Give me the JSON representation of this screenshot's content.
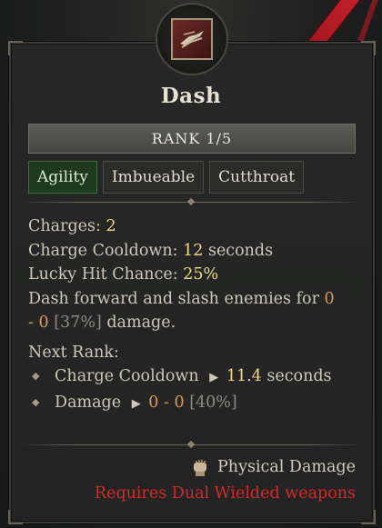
{
  "skill": {
    "name": "Dash",
    "rank_label": "RANK 1/5",
    "tags": [
      {
        "label": "Agility",
        "active": true
      },
      {
        "label": "Imbueable",
        "active": false
      },
      {
        "label": "Cutthroat",
        "active": false
      }
    ]
  },
  "stats": {
    "charges_label": "Charges:",
    "charges_value": "2",
    "cooldown_label": "Charge Cooldown:",
    "cooldown_value": "12",
    "cooldown_unit": "seconds",
    "lucky_label": "Lucky Hit Chance:",
    "lucky_value": "25%",
    "desc_part1": "Dash forward and slash enemies for",
    "desc_min": "0",
    "desc_sep": "-",
    "desc_max": "0",
    "desc_pct": "[37%]",
    "desc_part2": "damage."
  },
  "next_rank": {
    "title": "Next Rank:",
    "cooldown_label": "Charge Cooldown",
    "cooldown_value": "11.4",
    "cooldown_unit": "seconds",
    "damage_label": "Damage",
    "damage_min": "0",
    "damage_sep": "-",
    "damage_max": "0",
    "damage_pct": "[40%]"
  },
  "footer": {
    "damage_type": "Physical Damage",
    "requirement": "Requires Dual Wielded weapons"
  },
  "colors": {
    "value_yellow": "#f0d98a",
    "value_orange": "#d99b54",
    "requirement_red": "#d32a2a",
    "active_tag_green": "#1d3a1f"
  },
  "icons": {
    "skill": "dash-skill-icon",
    "damage_type": "fist-icon",
    "bullet": "diamond-bullet-icon",
    "arrow": "right-triangle-icon"
  }
}
